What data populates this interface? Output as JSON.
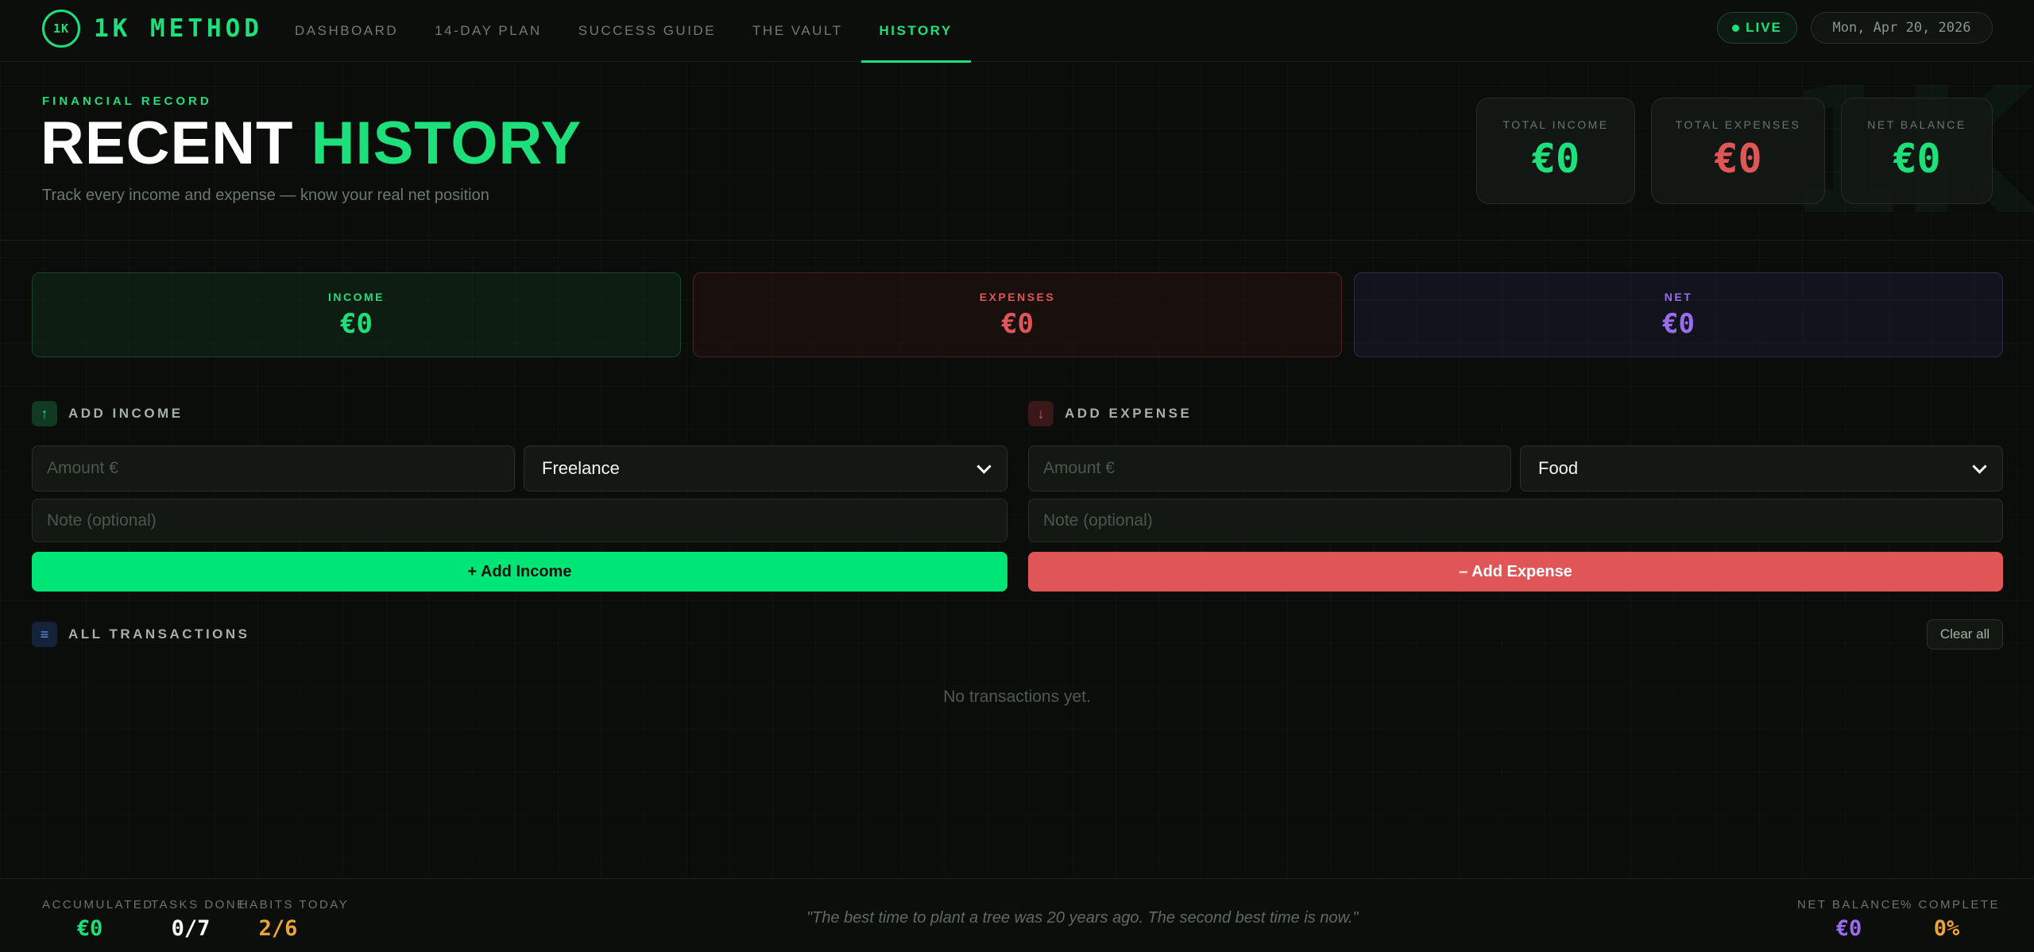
{
  "brand": {
    "badge": "1K",
    "name": "1K METHOD"
  },
  "nav": {
    "tabs": [
      {
        "label": "DASHBOARD",
        "active": false
      },
      {
        "label": "14-DAY PLAN",
        "active": false
      },
      {
        "label": "SUCCESS GUIDE",
        "active": false
      },
      {
        "label": "THE VAULT",
        "active": false
      },
      {
        "label": "HISTORY",
        "active": true
      }
    ],
    "live": "LIVE",
    "date": "Mon, Apr 20, 2026"
  },
  "header": {
    "eyebrow": "FINANCIAL RECORD",
    "title_white": "RECENT",
    "title_green": "HISTORY",
    "subtitle": "Track every income and expense — know your real net position",
    "watermark": "1K",
    "stats": [
      {
        "label": "TOTAL INCOME",
        "value": "€0"
      },
      {
        "label": "TOTAL EXPENSES",
        "value": "€0"
      },
      {
        "label": "NET BALANCE",
        "value": "€0"
      }
    ]
  },
  "summary": {
    "income": {
      "label": "INCOME",
      "value": "€0"
    },
    "expenses": {
      "label": "EXPENSES",
      "value": "€0"
    },
    "net": {
      "label": "NET",
      "value": "€0"
    }
  },
  "income_form": {
    "heading": "ADD INCOME",
    "amount_placeholder": "Amount €",
    "category": "Freelance",
    "note_placeholder": "Note (optional)",
    "button": "+ Add Income"
  },
  "expense_form": {
    "heading": "ADD EXPENSE",
    "amount_placeholder": "Amount €",
    "category": "Food",
    "note_placeholder": "Note (optional)",
    "button": "– Add Expense"
  },
  "transactions": {
    "heading": "ALL TRANSACTIONS",
    "clear": "Clear all",
    "empty": "No transactions yet."
  },
  "footer": {
    "left_stats": [
      {
        "label": "ACCUMULATED",
        "value": "€0"
      },
      {
        "label": "TASKS DONE",
        "value": "0/7"
      },
      {
        "label": "HABITS TODAY",
        "value": "2/6"
      }
    ],
    "quote": "\"The best time to plant a tree was 20 years ago. The second best time is now.\"",
    "right_stats": [
      {
        "label": "NET BALANCE",
        "value": "€0"
      },
      {
        "label": "% COMPLETE",
        "value": "0%"
      }
    ]
  },
  "colors": {
    "accent": "#1ee07a",
    "expense": "#e05555",
    "net": "#9b6cf0",
    "habits": "#f0a23a"
  }
}
